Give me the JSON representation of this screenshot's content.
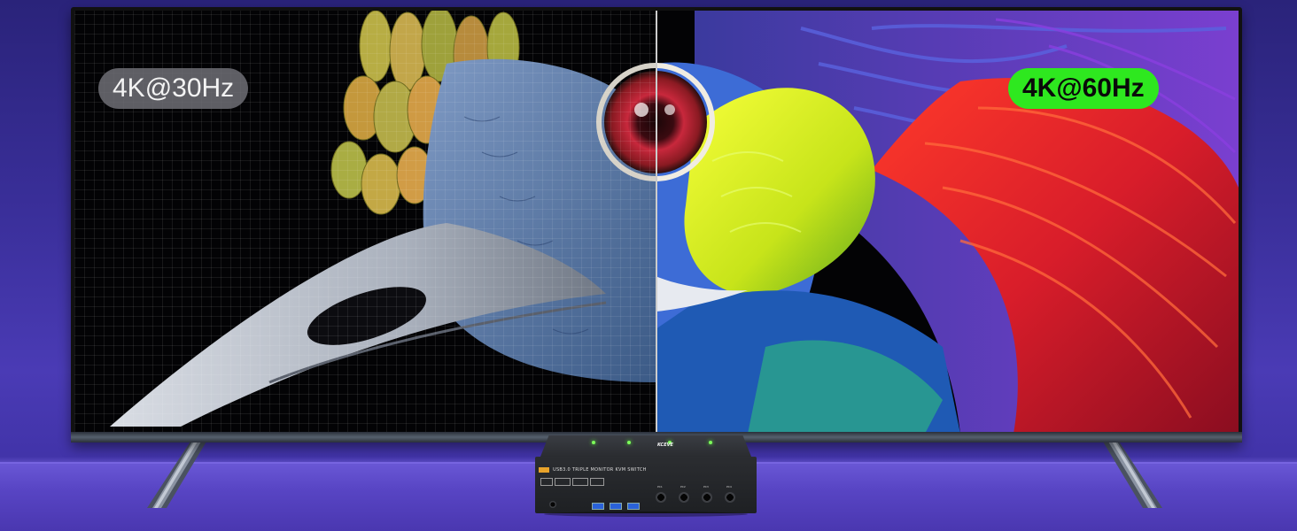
{
  "screen": {
    "left_badge": "4K@30Hz",
    "right_badge": "4K@60Hz",
    "right_badge_color": "#2ee81f",
    "left_badge_color": "#6e6e76"
  },
  "kvm_switch": {
    "brand": "KCEVE",
    "model_label": "USB3.0 TRIPLE MONITOR KVM SWITCH",
    "model_badge": "3X4",
    "ports": [
      "PC1",
      "PC2",
      "PC3",
      "PC4"
    ],
    "led_color": "#7dff5a"
  },
  "colors": {
    "background": "#3a2f9a",
    "floor": "#5845c4"
  }
}
